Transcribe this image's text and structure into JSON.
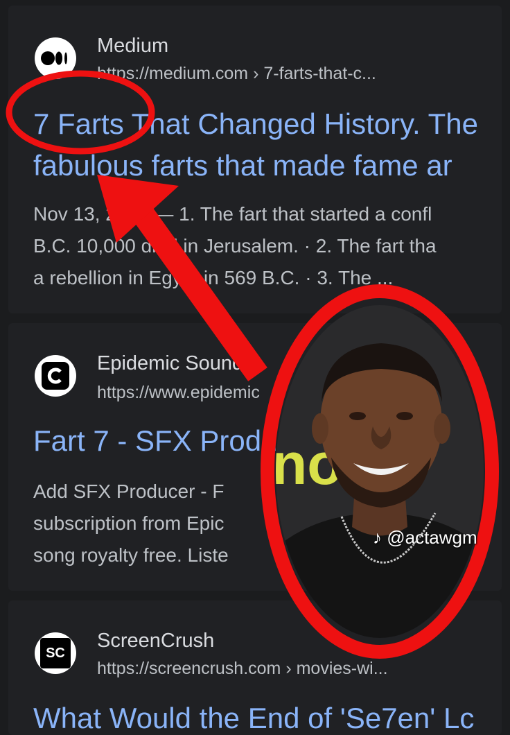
{
  "results": [
    {
      "site": "Medium",
      "url": "https://medium.com › 7-farts-that-c...",
      "title_lines": [
        "7 Farts That Changed History. The",
        "fabulous farts that made fame ar"
      ],
      "snippet_lines": [
        "Nov 13, 2020 — 1. The fart that started a confl",
        "B.C. 10,000 died in Jerusalem. · 2. The fart tha",
        "a rebellion in Egypt in 569 B.C. · 3. The ..."
      ],
      "icon": "medium-logo-icon"
    },
    {
      "site": "Epidemic Sound",
      "url": "https://www.epidemic",
      "title_lines": [
        "Fart 7 - SFX Producer"
      ],
      "snippet_lines": [
        "Add SFX Producer - F",
        "subscription from Epic",
        "song royalty free. Liste"
      ],
      "icon": "epidemic-sound-logo-icon"
    },
    {
      "site": "ScreenCrush",
      "url": "https://screencrush.com › movies-wi...",
      "title_lines": [
        "What Would the End of 'Se7en' Lc"
      ],
      "icon": "screencrush-logo-icon",
      "icon_text": "SC"
    }
  ],
  "photo_backdrop_text": "no",
  "watermark": "@actawgm",
  "colors": {
    "background": "#1b1c1e",
    "card": "#202124",
    "link_blue": "#8ab4f8",
    "snippet_gray": "#bdc1c6",
    "annotation_red": "#ee1111"
  }
}
